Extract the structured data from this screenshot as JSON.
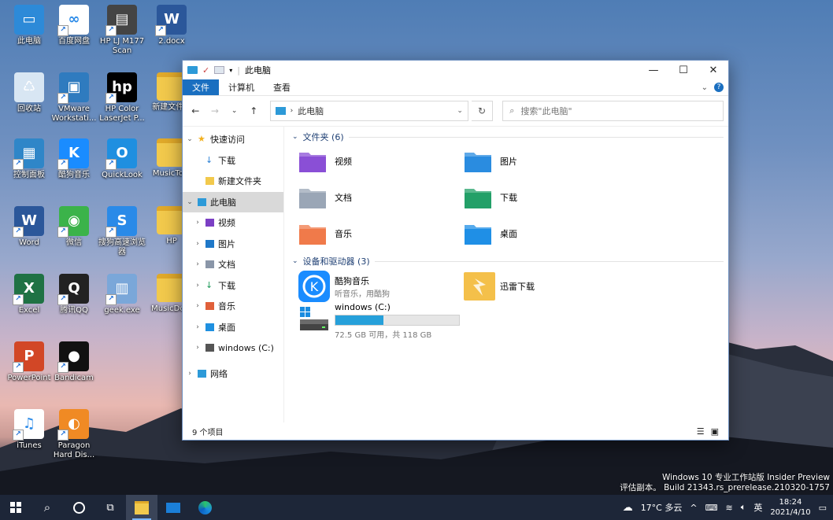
{
  "desktop": {
    "icons": [
      {
        "label": "此电脑",
        "color": "#2d8ad8",
        "glyph": "▭"
      },
      {
        "label": "百度网盘",
        "color": "#ffffff",
        "glyph": "∞"
      },
      {
        "label": "HP LJ M177 Scan",
        "color": "#444444",
        "glyph": "▤"
      },
      {
        "label": "2.docx",
        "color": "#2b579a",
        "glyph": "W"
      },
      {
        "label": "回收站",
        "color": "#d8e6f3",
        "glyph": "♺"
      },
      {
        "label": "VMware Workstati...",
        "color": "#2f7bbf",
        "glyph": "▣"
      },
      {
        "label": "HP Color LaserJet P...",
        "color": "#000000",
        "glyph": "hp"
      },
      {
        "label": "新建文件...",
        "color": "#f2c94c",
        "glyph": ""
      },
      {
        "label": "控制面板",
        "color": "#2f86c8",
        "glyph": "▦"
      },
      {
        "label": "酷狗音乐",
        "color": "#1a8cff",
        "glyph": "K"
      },
      {
        "label": "QuickLook",
        "color": "#1f8fe0",
        "glyph": "O"
      },
      {
        "label": "MusicTo...",
        "color": "#f2c94c",
        "glyph": ""
      },
      {
        "label": "Word",
        "color": "#2b579a",
        "glyph": "W"
      },
      {
        "label": "微信",
        "color": "#3bb34a",
        "glyph": "◉"
      },
      {
        "label": "搜狗高速浏览器",
        "color": "#2a8ae8",
        "glyph": "S"
      },
      {
        "label": "HP",
        "color": "#f2c94c",
        "glyph": ""
      },
      {
        "label": "Excel",
        "color": "#1f7244",
        "glyph": "X"
      },
      {
        "label": "腾讯QQ",
        "color": "#222222",
        "glyph": "Q"
      },
      {
        "label": "geek.exe",
        "color": "#7aa7d9",
        "glyph": "▥"
      },
      {
        "label": "MusicDo...",
        "color": "#f2c94c",
        "glyph": ""
      },
      {
        "label": "PowerPoint",
        "color": "#d24726",
        "glyph": "P"
      },
      {
        "label": "Bandicam",
        "color": "#111111",
        "glyph": "●"
      },
      {
        "label": "iTunes",
        "color": "#ffffff",
        "glyph": "♫"
      },
      {
        "label": "Paragon Hard Dis...",
        "color": "#f08a24",
        "glyph": "◐"
      }
    ]
  },
  "window": {
    "title": "此电脑",
    "controls": {
      "minimize": "—",
      "maximize": "☐",
      "close": "✕"
    },
    "ribbon_tabs": [
      "文件",
      "计算机",
      "查看"
    ],
    "address": "此电脑",
    "search_placeholder": "搜索\"此电脑\"",
    "sidebar": [
      {
        "label": "快速访问",
        "level": 0,
        "expanded": true,
        "icon": "star-icon",
        "color": "#f2b01e"
      },
      {
        "label": "下载",
        "level": 1,
        "icon": "download-icon",
        "color": "#2a7fd4"
      },
      {
        "label": "新建文件夹",
        "level": 1,
        "icon": "folder-icon",
        "color": "#f2c94c"
      },
      {
        "label": "此电脑",
        "level": 0,
        "expanded": true,
        "selected": true,
        "icon": "computer-icon",
        "color": "#2d9ad8"
      },
      {
        "label": "视频",
        "level": 1,
        "collapsed": true,
        "icon": "video-icon",
        "color": "#7b3fc4"
      },
      {
        "label": "图片",
        "level": 1,
        "collapsed": true,
        "icon": "picture-icon",
        "color": "#1f78c8"
      },
      {
        "label": "文档",
        "level": 1,
        "collapsed": true,
        "icon": "document-icon",
        "color": "#8a96a8"
      },
      {
        "label": "下载",
        "level": 1,
        "collapsed": true,
        "icon": "download-icon",
        "color": "#1f9a5a"
      },
      {
        "label": "音乐",
        "level": 1,
        "collapsed": true,
        "icon": "music-icon",
        "color": "#e0603a"
      },
      {
        "label": "桌面",
        "level": 1,
        "collapsed": true,
        "icon": "desktop-icon",
        "color": "#1f90e0"
      },
      {
        "label": "windows (C:)",
        "level": 1,
        "collapsed": true,
        "icon": "drive-icon",
        "color": "#555555"
      },
      {
        "label": "网络",
        "level": 0,
        "collapsed": true,
        "icon": "network-icon",
        "color": "#2d9ad8"
      }
    ],
    "folders_group": "文件夹 (6)",
    "folders": [
      {
        "label": "视频",
        "icon": "video-folder-icon",
        "color": "#8a4fd6"
      },
      {
        "label": "图片",
        "icon": "picture-folder-icon",
        "color": "#2a8ce0"
      },
      {
        "label": "文档",
        "icon": "document-folder-icon",
        "color": "#9aa6b6"
      },
      {
        "label": "下载",
        "icon": "download-folder-icon",
        "color": "#23a068"
      },
      {
        "label": "音乐",
        "icon": "music-folder-icon",
        "color": "#f07a4a"
      },
      {
        "label": "桌面",
        "icon": "desktop-folder-icon",
        "color": "#1f8fe6"
      }
    ],
    "devices_group": "设备和驱动器 (3)",
    "devices": [
      {
        "label": "酷狗音乐",
        "sub": "听音乐，用酷狗",
        "icon": "kugou-icon",
        "color": "#1a8cff"
      },
      {
        "label": "迅雷下载",
        "sub": "",
        "icon": "thunder-icon",
        "color": "#f4c04a"
      },
      {
        "label": "windows (C:)",
        "sub": "72.5 GB 可用，共 118 GB",
        "icon": "drive-icon",
        "color": "#555555",
        "used_fraction": 0.386
      }
    ],
    "status": "9 个项目"
  },
  "watermark": {
    "line1": "Windows 10 专业工作站版 Insider Preview",
    "line2": "评估副本。 Build 21343.rs_prerelease.210320-1757"
  },
  "taskbar": {
    "weather": "17°C 多云",
    "ime": "英",
    "time": "18:24",
    "date": "2021/4/10",
    "accent": "#7cb7ff"
  }
}
